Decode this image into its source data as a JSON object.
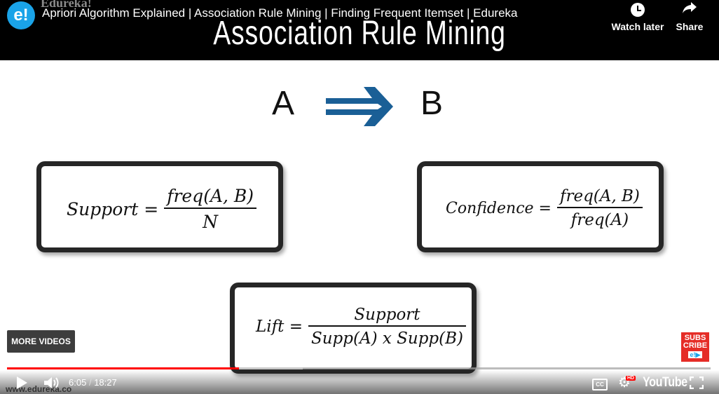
{
  "header": {
    "channel_logo": "e!",
    "channel_name_faint": "Edureka!",
    "video_title": "Apriori Algorithm Explained | Association Rule Mining | Finding Frequent Itemset | Edureka",
    "watch_later_label": "Watch later",
    "share_label": "Share"
  },
  "slide": {
    "heading": "Association Rule Mining",
    "rule_a": "A",
    "rule_b": "B",
    "arrow_color": "#1a5f96",
    "support": {
      "lhs": "Support =",
      "num": "freq(A, B)",
      "den": "N"
    },
    "confidence": {
      "lhs": "Confidence =",
      "num": "freq(A, B)",
      "den": "freq(A)"
    },
    "lift": {
      "lhs": "Lift =",
      "num": "Support",
      "den": "Supp(A) x Supp(B)"
    }
  },
  "overlay": {
    "more_videos_label": "MORE VIDEOS",
    "subscribe_line1": "SUBS",
    "subscribe_line2": "CRIBE",
    "subscribe_mini": "e!▶",
    "watermark": "www.edureka.co"
  },
  "player": {
    "current_time": "6:05",
    "separator": "/",
    "duration": "18:27",
    "played_fraction": 0.33,
    "buffered_fraction": 0.42,
    "cc_label": "CC",
    "hd_label": "HD",
    "brand": "YouTube",
    "accent_color": "#ff0000"
  }
}
